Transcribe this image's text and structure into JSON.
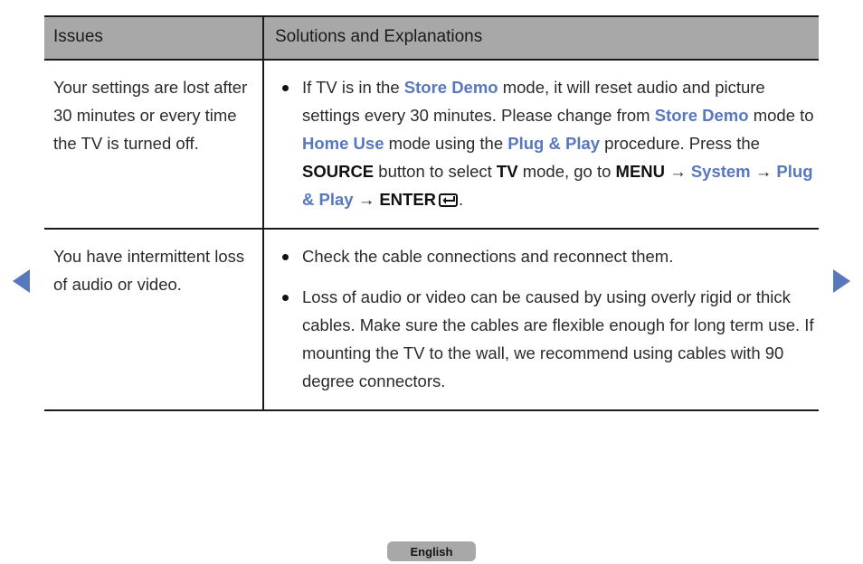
{
  "page": {
    "language_label": "English"
  },
  "nav": {
    "prev_label": "previous-page",
    "next_label": "next-page",
    "arrow_color": "#5878be"
  },
  "table": {
    "headers": {
      "issues": "Issues",
      "solutions": "Solutions and Explanations"
    },
    "header_background": "#a8a8a8",
    "rows": [
      {
        "issue": "Your settings are lost after 30 minutes or every time the TV is turned off.",
        "bullets": [
          {
            "segments": [
              {
                "text": "If TV is in the ",
                "style": "normal"
              },
              {
                "text": "Store Demo",
                "style": "blue"
              },
              {
                "text": " mode, it will reset audio and picture settings every 30 minutes. Please change from ",
                "style": "normal"
              },
              {
                "text": "Store Demo",
                "style": "blue"
              },
              {
                "text": " mode to ",
                "style": "normal"
              },
              {
                "text": "Home Use",
                "style": "blue"
              },
              {
                "text": " mode using the ",
                "style": "normal"
              },
              {
                "text": "Plug & Play",
                "style": "blue"
              },
              {
                "text": " procedure. Press the ",
                "style": "normal"
              },
              {
                "text": "SOURCE",
                "style": "bold"
              },
              {
                "text": " button to select ",
                "style": "normal"
              },
              {
                "text": "TV",
                "style": "bold"
              },
              {
                "text": " mode, go to ",
                "style": "normal"
              },
              {
                "text": "MENU",
                "style": "bold"
              },
              {
                "text": " → ",
                "style": "normal"
              },
              {
                "text": "System",
                "style": "blue"
              },
              {
                "text": " → ",
                "style": "normal"
              },
              {
                "text": "Plug & Play",
                "style": "blue"
              },
              {
                "text": " → ",
                "style": "normal"
              },
              {
                "text": "ENTER",
                "style": "bold"
              },
              {
                "text": "enter-key-icon",
                "style": "key"
              },
              {
                "text": ".",
                "style": "normal"
              }
            ]
          }
        ]
      },
      {
        "issue": "You have intermittent loss of audio or video.",
        "bullets": [
          {
            "segments": [
              {
                "text": "Check the cable connections and reconnect them.",
                "style": "normal"
              }
            ]
          },
          {
            "segments": [
              {
                "text": "Loss of audio or video can be caused by using overly rigid or thick cables. Make sure the cables are flexible enough for long term use. If mounting the TV to the wall, we recommend using cables with 90 degree connectors.",
                "style": "normal"
              }
            ]
          }
        ]
      }
    ]
  }
}
